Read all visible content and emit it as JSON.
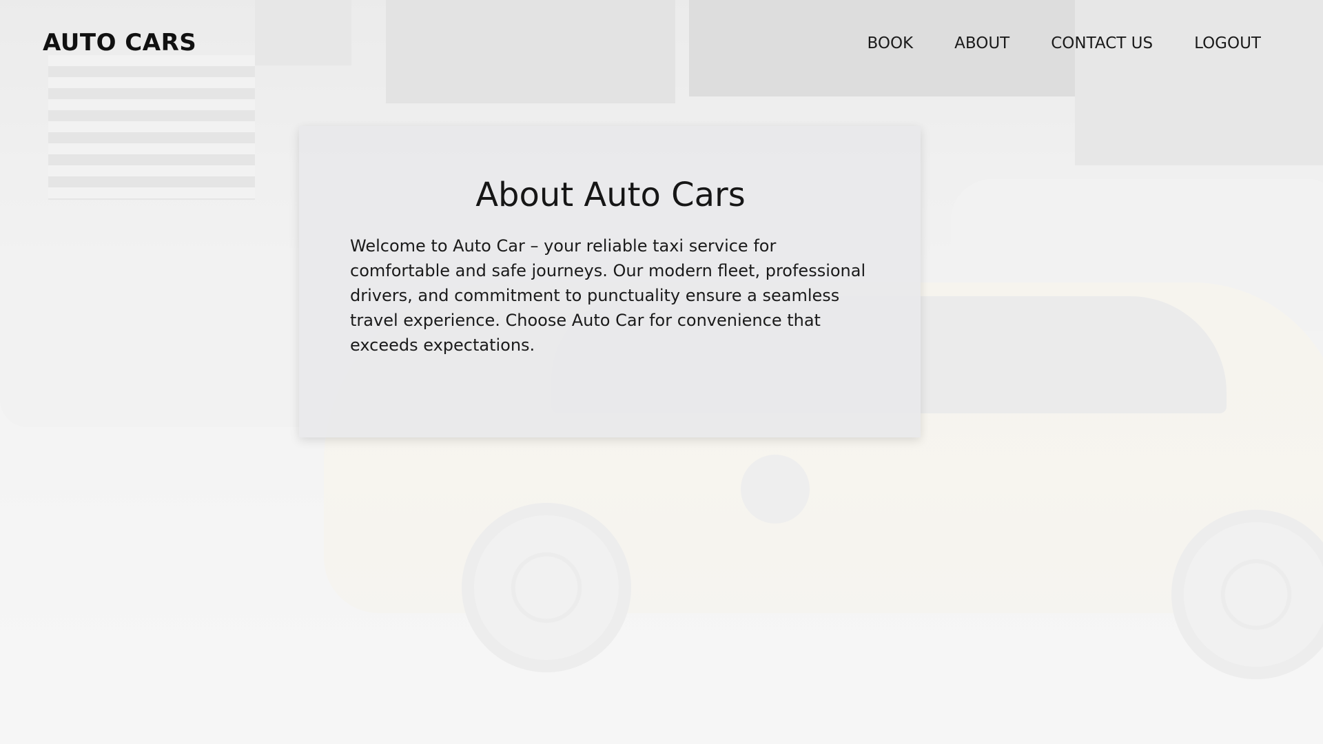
{
  "header": {
    "logo": "AUTO CARS",
    "nav": [
      {
        "label": "BOOK"
      },
      {
        "label": "ABOUT"
      },
      {
        "label": "CONTACT US"
      },
      {
        "label": "LOGOUT"
      }
    ]
  },
  "about": {
    "title": "About Auto Cars",
    "body": "Welcome to Auto Car – your reliable taxi service for comfortable and safe journeys. Our modern fleet, professional drivers, and commitment to punctuality ensure a seamless travel experience. Choose Auto Car for convenience that exceeds expectations."
  },
  "colors": {
    "text": "#111111",
    "card_background": "#e8e8ea"
  }
}
